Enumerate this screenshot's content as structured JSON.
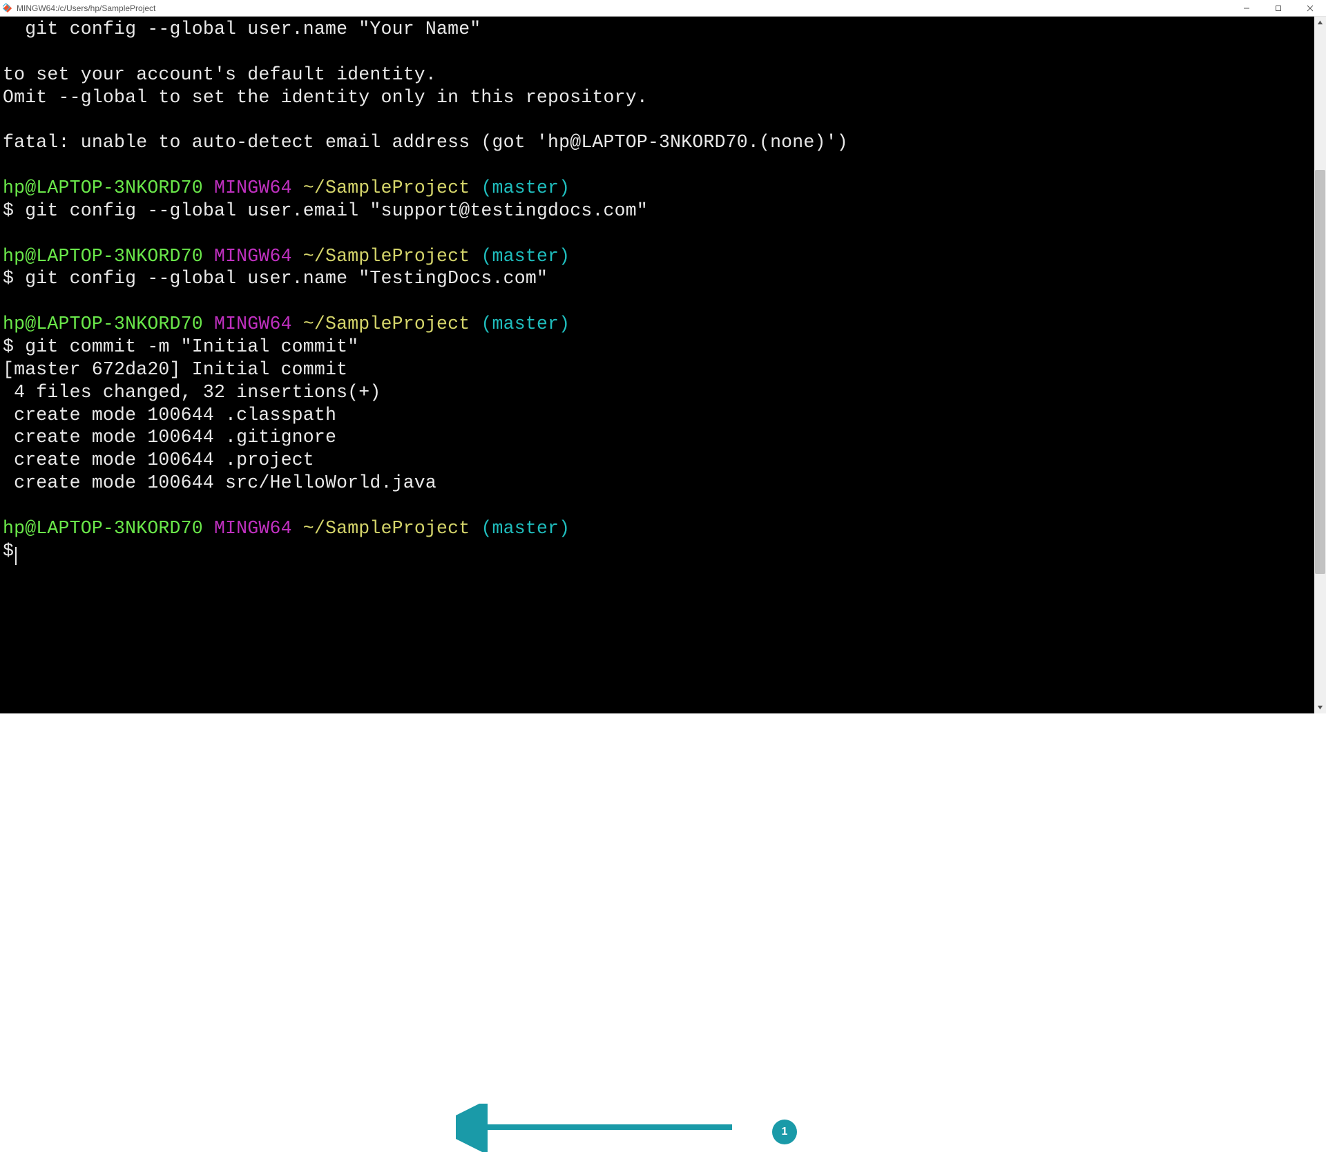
{
  "window": {
    "title": "MINGW64:/c/Users/hp/SampleProject"
  },
  "prompt": {
    "userhost": "hp@LAPTOP-3NKORD70",
    "env": "MINGW64",
    "path": "~/SampleProject",
    "branch": "(master)",
    "symbol": "$"
  },
  "lines": {
    "config_example": "  git config --global user.name \"Your Name\"",
    "set_default_1": "to set your account's default identity.",
    "set_default_2": "Omit --global to set the identity only in this repository.",
    "fatal": "fatal: unable to auto-detect email address (got 'hp@LAPTOP-3NKORD70.(none)')",
    "cmd_email": "git config --global user.email \"support@testingdocs.com\"",
    "cmd_name": "git config --global user.name \"TestingDocs.com\"",
    "cmd_commit": "git commit -m \"Initial commit\"",
    "commit_out_1": "[master 672da20] Initial commit",
    "commit_out_2": " 4 files changed, 32 insertions(+)",
    "commit_out_3": " create mode 100644 .classpath",
    "commit_out_4": " create mode 100644 .gitignore",
    "commit_out_5": " create mode 100644 .project",
    "commit_out_6": " create mode 100644 src/HelloWorld.java"
  },
  "annotation": {
    "badge": "1",
    "color": "#1a9aa8"
  }
}
